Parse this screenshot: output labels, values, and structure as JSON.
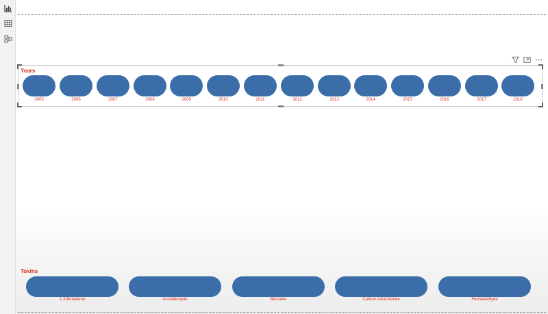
{
  "view_rail": {
    "buttons": [
      {
        "icon": "report-view-icon"
      },
      {
        "icon": "data-view-icon"
      },
      {
        "icon": "model-view-icon"
      }
    ]
  },
  "years_slicer": {
    "title": "Years",
    "items": [
      "2005",
      "2006",
      "2007",
      "2008",
      "2009",
      "2010",
      "2011",
      "2012",
      "2013",
      "2014",
      "2015",
      "2016",
      "2017",
      "2018"
    ],
    "header_icons": [
      "filter-icon",
      "focus-mode-icon",
      "more-options-icon"
    ]
  },
  "toxins_slicer": {
    "title": "Toxins",
    "items": [
      "1,3-Butadiene",
      "Acetaldehyde",
      "Benzene",
      "Carbon tetrachloride",
      "Formaldehyde"
    ]
  },
  "colors": {
    "pill": "#3b6ea8",
    "label": "#d52b1e",
    "rail": "#f3f2f1"
  }
}
